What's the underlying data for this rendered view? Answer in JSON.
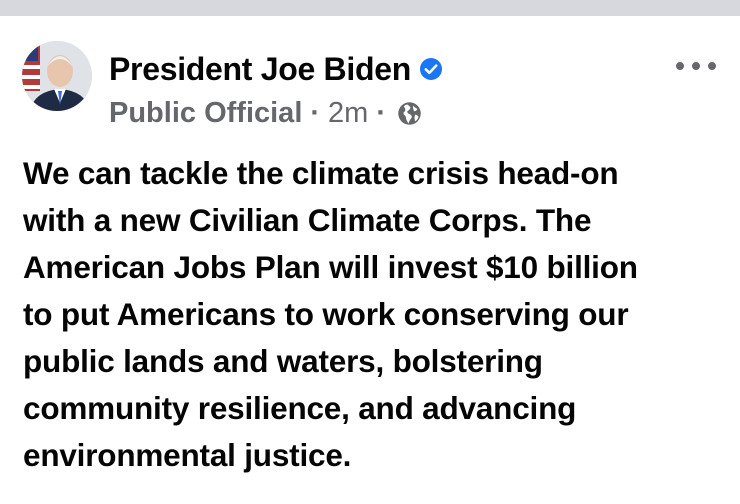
{
  "post": {
    "author": "President Joe Biden",
    "role": "Public Official",
    "separator": "·",
    "timestamp": "2m",
    "audience_icon": "globe-icon",
    "verified_icon": "verified-badge-icon",
    "more_icon": "more-options-icon",
    "text_lines": [
      "We can tackle the climate crisis head-on",
      "with a new Civilian Climate Corps. The",
      "American Jobs Plan will invest $10 billion",
      "to put Americans to work conserving our",
      "public lands and waters, bolstering",
      "community resilience, and advancing",
      "environmental justice."
    ]
  },
  "colors": {
    "verified": "#1877f2",
    "secondary_text": "#65676b",
    "primary_text": "#050505",
    "top_bar": "#d6d8dd"
  }
}
